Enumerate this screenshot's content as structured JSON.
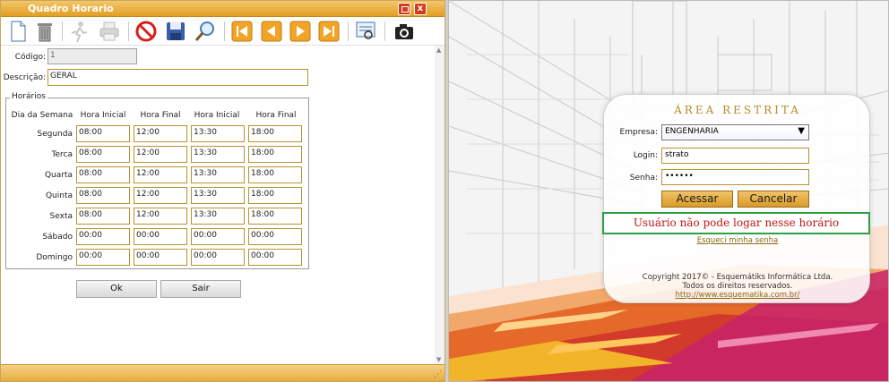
{
  "window": {
    "title": "Quadro Horario",
    "close_glyph": "x"
  },
  "toolbar": {
    "icons": [
      "new-document-icon",
      "trash-icon",
      "run-icon",
      "print-icon",
      "cancel-icon",
      "save-icon",
      "search-icon",
      "first-icon",
      "previous-icon",
      "next-icon",
      "last-icon",
      "preview-icon",
      "camera-icon"
    ]
  },
  "form": {
    "codigo_label": "Código:",
    "codigo_value": "1",
    "descricao_label": "Descrição:",
    "descricao_value": "GERAL",
    "horarios_legend": "Horários",
    "headers": [
      "Dia da Semana",
      "Hora Inicial",
      "Hora Final",
      "Hora Inicial",
      "Hora Final"
    ],
    "rows": [
      {
        "day": "Segunda",
        "times": [
          "08:00",
          "12:00",
          "13:30",
          "18:00"
        ]
      },
      {
        "day": "Terca",
        "times": [
          "08:00",
          "12:00",
          "13:30",
          "18:00"
        ]
      },
      {
        "day": "Quarta",
        "times": [
          "08:00",
          "12:00",
          "13:30",
          "18:00"
        ]
      },
      {
        "day": "Quinta",
        "times": [
          "08:00",
          "12:00",
          "13:30",
          "18:00"
        ]
      },
      {
        "day": "Sexta",
        "times": [
          "08:00",
          "12:00",
          "13:30",
          "18:00"
        ]
      },
      {
        "day": "Sábado",
        "times": [
          "00:00",
          "00:00",
          "00:00",
          "00:00"
        ]
      },
      {
        "day": "Domingo",
        "times": [
          "00:00",
          "00:00",
          "00:00",
          "00:00"
        ]
      }
    ],
    "ok_label": "Ok",
    "sair_label": "Sair"
  },
  "login": {
    "title": "ÁREA RESTRITA",
    "empresa_label": "Empresa:",
    "empresa_value": "ENGENHARIA",
    "login_label": "Login:",
    "login_value": "strato",
    "senha_label": "Senha:",
    "senha_value": "••••••",
    "acessar_label": "Acessar",
    "cancelar_label": "Cancelar",
    "error_message": "Usuário não pode logar nesse horário",
    "forgot_link": "Esqueci minha senha",
    "copyright_line1": "Copyright 2017© - Esquemátiks Informática Ltda.",
    "copyright_line2": "Todos os direitos reservados.",
    "copyright_link": "http://www.esquematika.com.br/"
  },
  "colors": {
    "accent": "#e29f23",
    "error": "#c01515",
    "message_border": "#2f9f46",
    "link": "#8a6a14"
  }
}
